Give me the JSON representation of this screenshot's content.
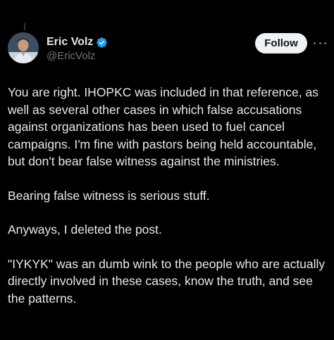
{
  "author": {
    "display_name": "Eric Volz",
    "handle": "@EricVolz",
    "verified": true,
    "avatar_icon": "profile-photo"
  },
  "actions": {
    "follow_label": "Follow",
    "more_icon": "more-horizontal-icon"
  },
  "colors": {
    "background": "#000000",
    "text_primary": "#e7e9ea",
    "text_secondary": "#71767b",
    "verified_blue": "#1d9bf0",
    "follow_bg": "#eff3f4",
    "follow_text": "#0f1419"
  },
  "tweet": {
    "paragraphs": [
      "You are right. IHOPKC was included in that reference, as well as several other cases in which false accusations against organizations has been used to fuel cancel campaigns. I'm fine with pastors being held accountable, but don't bear false witness against the ministries.",
      "Bearing false witness is serious stuff.",
      "Anyways, I deleted the post.",
      "\"IYKYK\" was an dumb wink to the people who are actually directly involved in these cases, know the truth, and see the patterns."
    ]
  }
}
